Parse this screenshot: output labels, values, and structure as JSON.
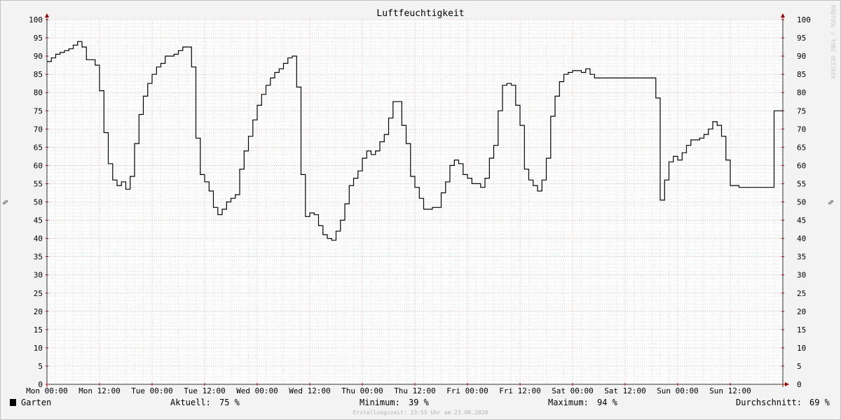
{
  "chart_data": {
    "type": "line",
    "title": "Luftfeuchtigkeit",
    "ylabel": "%",
    "watermark": "RRDTOOL / TOBI OETIKER",
    "ylim": [
      0,
      100
    ],
    "yticks": [
      0,
      5,
      10,
      15,
      20,
      25,
      30,
      35,
      40,
      45,
      50,
      55,
      60,
      65,
      70,
      75,
      80,
      85,
      90,
      95,
      100
    ],
    "x_tick_labels": [
      "Mon 00:00",
      "Mon 12:00",
      "Tue 00:00",
      "Tue 12:00",
      "Wed 00:00",
      "Wed 12:00",
      "Thu 00:00",
      "Thu 12:00",
      "Fri 00:00",
      "Fri 12:00",
      "Sat 00:00",
      "Sat 12:00",
      "Sun 00:00",
      "Sun 12:00"
    ],
    "x_unit": "hours",
    "xlim": [
      0,
      168
    ],
    "grid": true,
    "series": [
      {
        "name": "Garten",
        "color": "#000000",
        "points": [
          [
            0,
            88.5
          ],
          [
            1,
            89.5
          ],
          [
            2,
            90.5
          ],
          [
            3,
            91
          ],
          [
            4,
            91.5
          ],
          [
            5,
            92
          ],
          [
            6,
            93
          ],
          [
            7,
            94
          ],
          [
            8,
            92.5
          ],
          [
            9,
            89
          ],
          [
            10,
            89
          ],
          [
            11,
            87.5
          ],
          [
            12,
            80.5
          ],
          [
            13,
            69
          ],
          [
            14,
            60.5
          ],
          [
            15,
            56
          ],
          [
            16,
            54.5
          ],
          [
            17,
            55.5
          ],
          [
            18,
            53.5
          ],
          [
            19,
            57
          ],
          [
            20,
            66
          ],
          [
            21,
            74
          ],
          [
            22,
            79
          ],
          [
            23,
            82.5
          ],
          [
            24,
            85
          ],
          [
            25,
            87
          ],
          [
            26,
            88
          ],
          [
            27,
            90
          ],
          [
            28,
            90
          ],
          [
            29,
            90.5
          ],
          [
            30,
            91.5
          ],
          [
            31,
            92.5
          ],
          [
            32,
            92.5
          ],
          [
            33,
            87
          ],
          [
            34,
            67.5
          ],
          [
            35,
            57.5
          ],
          [
            36,
            55.5
          ],
          [
            37,
            53
          ],
          [
            38,
            48.5
          ],
          [
            39,
            46.5
          ],
          [
            40,
            48
          ],
          [
            41,
            50
          ],
          [
            42,
            51
          ],
          [
            43,
            52
          ],
          [
            44,
            59
          ],
          [
            45,
            64
          ],
          [
            46,
            68
          ],
          [
            47,
            72.5
          ],
          [
            48,
            76.5
          ],
          [
            49,
            79.5
          ],
          [
            50,
            82
          ],
          [
            51,
            84
          ],
          [
            52,
            85.5
          ],
          [
            53,
            86.5
          ],
          [
            54,
            88
          ],
          [
            55,
            89.5
          ],
          [
            56,
            90
          ],
          [
            57,
            81.5
          ],
          [
            58,
            57.5
          ],
          [
            59,
            46
          ],
          [
            60,
            47
          ],
          [
            61,
            46.5
          ],
          [
            62,
            43.5
          ],
          [
            63,
            41
          ],
          [
            64,
            40
          ],
          [
            65,
            39.5
          ],
          [
            66,
            42
          ],
          [
            67,
            45
          ],
          [
            68,
            49.5
          ],
          [
            69,
            54.5
          ],
          [
            70,
            56.5
          ],
          [
            71,
            58.5
          ],
          [
            72,
            62
          ],
          [
            73,
            64
          ],
          [
            74,
            63
          ],
          [
            75,
            64
          ],
          [
            76,
            66.5
          ],
          [
            77,
            68.5
          ],
          [
            78,
            73
          ],
          [
            79,
            77.5
          ],
          [
            80,
            77.5
          ],
          [
            81,
            71
          ],
          [
            82,
            66
          ],
          [
            83,
            57
          ],
          [
            84,
            54
          ],
          [
            85,
            51
          ],
          [
            86,
            48
          ],
          [
            87,
            48
          ],
          [
            88,
            48.5
          ],
          [
            89,
            48.5
          ],
          [
            90,
            52.5
          ],
          [
            91,
            55.5
          ],
          [
            92,
            60
          ],
          [
            93,
            61.5
          ],
          [
            94,
            60.5
          ],
          [
            95,
            57.5
          ],
          [
            96,
            56.5
          ],
          [
            97,
            55
          ],
          [
            98,
            55
          ],
          [
            99,
            54
          ],
          [
            100,
            56.5
          ],
          [
            101,
            62
          ],
          [
            102,
            65.5
          ],
          [
            103,
            75
          ],
          [
            104,
            82
          ],
          [
            105,
            82.5
          ],
          [
            106,
            82
          ],
          [
            107,
            76.5
          ],
          [
            108,
            71
          ],
          [
            109,
            59
          ],
          [
            110,
            56
          ],
          [
            111,
            54.5
          ],
          [
            112,
            53
          ],
          [
            113,
            56
          ],
          [
            114,
            62
          ],
          [
            115,
            73.5
          ],
          [
            116,
            79
          ],
          [
            117,
            83
          ],
          [
            118,
            85
          ],
          [
            119,
            85.5
          ],
          [
            120,
            86
          ],
          [
            121,
            86
          ],
          [
            122,
            85.5
          ],
          [
            123,
            86.5
          ],
          [
            124,
            85
          ],
          [
            125,
            84
          ],
          [
            126,
            84
          ],
          [
            133,
            84
          ],
          [
            138,
            84
          ],
          [
            139,
            78.5
          ],
          [
            140,
            50.5
          ],
          [
            141,
            56
          ],
          [
            142,
            61
          ],
          [
            143,
            62.5
          ],
          [
            144,
            61.5
          ],
          [
            145,
            63.5
          ],
          [
            146,
            65.5
          ],
          [
            147,
            67
          ],
          [
            148,
            67
          ],
          [
            149,
            67.5
          ],
          [
            150,
            68.5
          ],
          [
            151,
            70
          ],
          [
            152,
            72
          ],
          [
            153,
            71
          ],
          [
            154,
            68
          ],
          [
            155,
            61.5
          ],
          [
            156,
            54.5
          ],
          [
            157,
            54.5
          ],
          [
            158,
            54
          ],
          [
            165,
            54
          ],
          [
            166,
            75
          ],
          [
            167,
            75
          ]
        ]
      }
    ]
  },
  "legend": {
    "series_name": "Garten",
    "current_label": "Aktuell:",
    "current_value": "75 %",
    "min_label": "Minimum:",
    "min_value": "39 %",
    "max_label": "Maximum:",
    "max_value": "94 %",
    "avg_label": "Durchschnitt:",
    "avg_value": "69 %"
  },
  "footer": {
    "created": "Erstellungszeit: 23:55 Uhr am 23.08.2020"
  },
  "colors": {
    "background": "#f3f3f3",
    "plot_background": "#ffffff",
    "major_grid": "#e08080",
    "minor_grid": "#c8c8c8",
    "line": "#000000",
    "axis_arrow": "#a00000"
  }
}
